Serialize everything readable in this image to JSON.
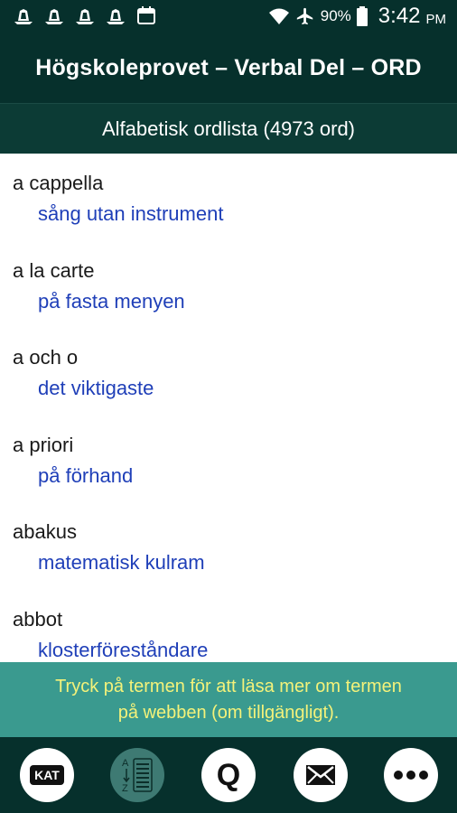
{
  "status_bar": {
    "battery": "90%",
    "time": "3:42",
    "ampm": "PM",
    "icons": [
      "ship-notification-icon",
      "ship-notification-icon",
      "ship-notification-icon",
      "ship-notification-icon",
      "calendar-icon",
      "wifi-icon",
      "airplane-icon",
      "battery-icon"
    ]
  },
  "app_bar": {
    "title": "Högskoleprovet – Verbal Del – ORD"
  },
  "sub_header": {
    "title": "Alfabetisk ordlista (4973 ord)"
  },
  "words": [
    {
      "term": "a cappella",
      "definition": "sång utan instrument"
    },
    {
      "term": "a la carte",
      "definition": "på fasta menyen"
    },
    {
      "term": "a och o",
      "definition": "det viktigaste"
    },
    {
      "term": "a priori",
      "definition": "på förhand"
    },
    {
      "term": "abakus",
      "definition": "matematisk kulram"
    },
    {
      "term": "abbot",
      "definition": "klosterföreståndare"
    }
  ],
  "hint": {
    "text": "Tryck på termen för att läsa mer om termen på webben (om tillgängligt)."
  },
  "bottom_nav": {
    "kat_label": "KAT",
    "az_label": "AZ",
    "quiz_label": "Q",
    "items": [
      "kat-category-icon",
      "alphabetical-list-icon",
      "quiz-icon",
      "mail-icon",
      "more-icon"
    ]
  },
  "colors": {
    "bar_background": "#06302c",
    "hint_background": "#3a9a8f",
    "hint_text": "#f4f27a",
    "definition_text": "#1f3fb8"
  }
}
